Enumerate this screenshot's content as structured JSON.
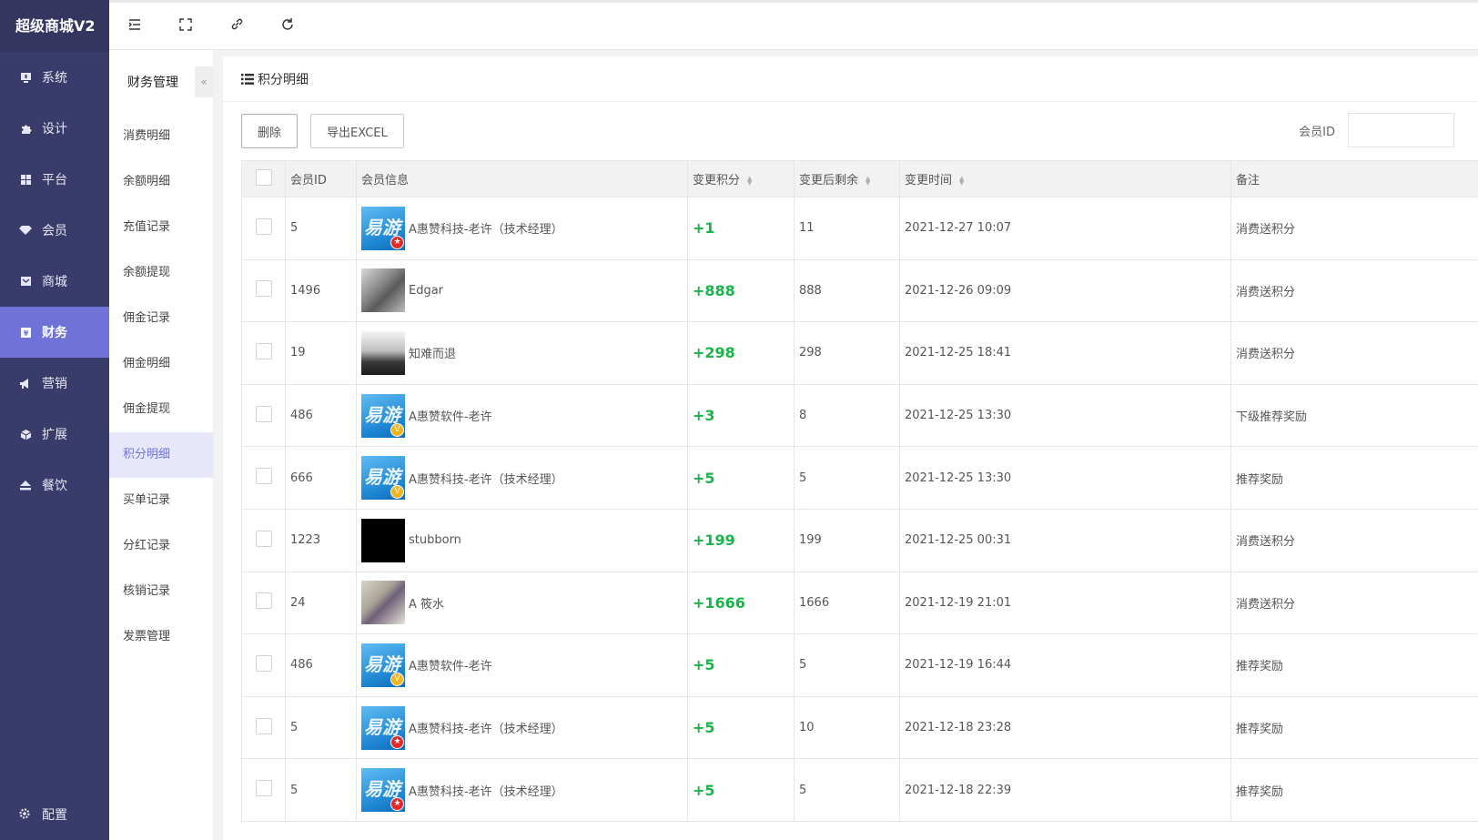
{
  "app": {
    "title": "超级商城V2"
  },
  "colors": {
    "sidebar": "#393b6b",
    "accent": "#6f73d8",
    "positive": "#19b44a"
  },
  "nav": [
    {
      "label": "系统",
      "icon": "monitor-icon"
    },
    {
      "label": "设计",
      "icon": "puzzle-icon"
    },
    {
      "label": "平台",
      "icon": "grid-icon"
    },
    {
      "label": "会员",
      "icon": "diamond-icon"
    },
    {
      "label": "商城",
      "icon": "mail-icon"
    },
    {
      "label": "财务",
      "icon": "finance-icon",
      "active": true
    },
    {
      "label": "营销",
      "icon": "megaphone-icon"
    },
    {
      "label": "扩展",
      "icon": "cube-icon"
    },
    {
      "label": "餐饮",
      "icon": "eject-icon"
    }
  ],
  "nav_bottom": {
    "label": "配置",
    "icon": "gear-icon"
  },
  "subnav": {
    "title": "财务管理",
    "items": [
      "消费明细",
      "余额明细",
      "充值记录",
      "余额提现",
      "佣金记录",
      "佣金明细",
      "佣金提现",
      "积分明细",
      "买单记录",
      "分红记录",
      "核销记录",
      "发票管理"
    ],
    "active": "积分明细"
  },
  "panel": {
    "title": "积分明细"
  },
  "toolbar": {
    "delete_label": "删除",
    "export_label": "导出EXCEL",
    "filter_label": "会员ID",
    "filter_value": ""
  },
  "table": {
    "headers": {
      "member_id": "会员ID",
      "member_info": "会员信息",
      "change": "变更积分",
      "remaining": "变更后剩余",
      "time": "变更时间",
      "remark": "备注"
    },
    "rows": [
      {
        "id": "5",
        "avatar": "logo-red",
        "name": "A惠赞科技-老许（技术经理）",
        "change": "+1",
        "remaining": "11",
        "time": "2021-12-27 10:07",
        "remark": "消费送积分"
      },
      {
        "id": "1496",
        "avatar": "photo1",
        "name": "Edgar",
        "change": "+888",
        "remaining": "888",
        "time": "2021-12-26 09:09",
        "remark": "消费送积分"
      },
      {
        "id": "19",
        "avatar": "photo2",
        "name": "知难而退",
        "change": "+298",
        "remaining": "298",
        "time": "2021-12-25 18:41",
        "remark": "消费送积分"
      },
      {
        "id": "486",
        "avatar": "logo-gold",
        "name": "A惠赞软件-老许",
        "change": "+3",
        "remaining": "8",
        "time": "2021-12-25 13:30",
        "remark": "下级推荐奖励"
      },
      {
        "id": "666",
        "avatar": "logo-gold",
        "name": "A惠赞科技-老许（技术经理）",
        "change": "+5",
        "remaining": "5",
        "time": "2021-12-25 13:30",
        "remark": "推荐奖励"
      },
      {
        "id": "1223",
        "avatar": "black",
        "name": "stubborn",
        "change": "+199",
        "remaining": "199",
        "time": "2021-12-25 00:31",
        "remark": "消费送积分"
      },
      {
        "id": "24",
        "avatar": "photo3",
        "name": "A 筱水",
        "change": "+1666",
        "remaining": "1666",
        "time": "2021-12-19 21:01",
        "remark": "消费送积分"
      },
      {
        "id": "486",
        "avatar": "logo-gold",
        "name": "A惠赞软件-老许",
        "change": "+5",
        "remaining": "5",
        "time": "2021-12-19 16:44",
        "remark": "推荐奖励"
      },
      {
        "id": "5",
        "avatar": "logo-red",
        "name": "A惠赞科技-老许（技术经理）",
        "change": "+5",
        "remaining": "10",
        "time": "2021-12-18 23:28",
        "remark": "推荐奖励"
      },
      {
        "id": "5",
        "avatar": "logo-red",
        "name": "A惠赞科技-老许（技术经理）",
        "change": "+5",
        "remaining": "5",
        "time": "2021-12-18 22:39",
        "remark": "推荐奖励"
      }
    ]
  }
}
